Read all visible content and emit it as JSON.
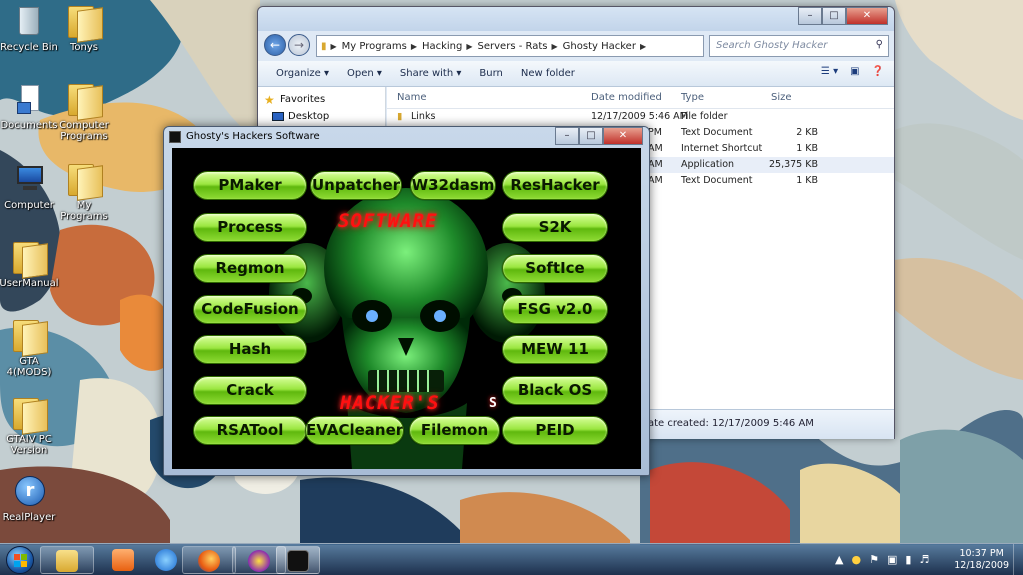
{
  "desktop": {
    "icons": [
      {
        "label": "Recycle Bin"
      },
      {
        "label": "Tonys"
      },
      {
        "label": "Documents"
      },
      {
        "label": "Computer Programs"
      },
      {
        "label": "Computer"
      },
      {
        "label": "My Programs"
      },
      {
        "label": "UserManual"
      },
      {
        "label": "GTA 4(MODS)"
      },
      {
        "label": "GTAIV PC Version"
      },
      {
        "label": "RealPlayer"
      }
    ]
  },
  "explorer": {
    "breadcrumbs": [
      "My Programs",
      "Hacking",
      "Servers - Rats",
      "Ghosty Hacker"
    ],
    "search_placeholder": "Search Ghosty Hacker",
    "toolbar": {
      "organize": "Organize ▾",
      "open": "Open ▾",
      "share_with": "Share with ▾",
      "burn": "Burn",
      "new_folder": "New folder"
    },
    "nav": {
      "favorites": "Favorites",
      "desktop": "Desktop"
    },
    "columns": {
      "name": "Name",
      "date_modified": "Date modified",
      "type": "Type",
      "size": "Size"
    },
    "files": [
      {
        "name": "Links",
        "date": "12/17/2009 5:46 AM",
        "type": "File folder",
        "size": ""
      },
      {
        "name": "",
        "date": "PM",
        "type": "Text Document",
        "size": "2 KB"
      },
      {
        "name": "",
        "date": "AM",
        "type": "Internet Shortcut",
        "size": "1 KB"
      },
      {
        "name": "",
        "date": "AM",
        "type": "Application",
        "size": "25,375 KB"
      },
      {
        "name": "",
        "date": "AM",
        "type": "Text Document",
        "size": "1 KB"
      }
    ],
    "details": "ate created: 12/17/2009 5:46 AM"
  },
  "ghosty": {
    "title": "Ghosty's Hackers Software",
    "neon_top": "SOFTWARE",
    "neon_bottom": "HACKER'S",
    "neon_s": "S",
    "buttons": {
      "pmaker": "PMaker",
      "unpatcher": "Unpatcher",
      "w32dasm": "W32dasm",
      "reshacker": "ResHacker",
      "process": "Process",
      "s2k": "S2K",
      "regmon": "Regmon",
      "softice": "SoftIce",
      "codefusion": "CodeFusion",
      "fsg": "FSG v2.0",
      "hash": "Hash",
      "mew": "MEW 11",
      "crack": "Crack",
      "blackos": "Black OS",
      "rsatool": "RSATool",
      "evacleaner": "EVACleaner",
      "filemon": "Filemon",
      "peid": "PEID"
    }
  },
  "taskbar": {
    "time": "10:37 PM",
    "date": "12/18/2009"
  }
}
